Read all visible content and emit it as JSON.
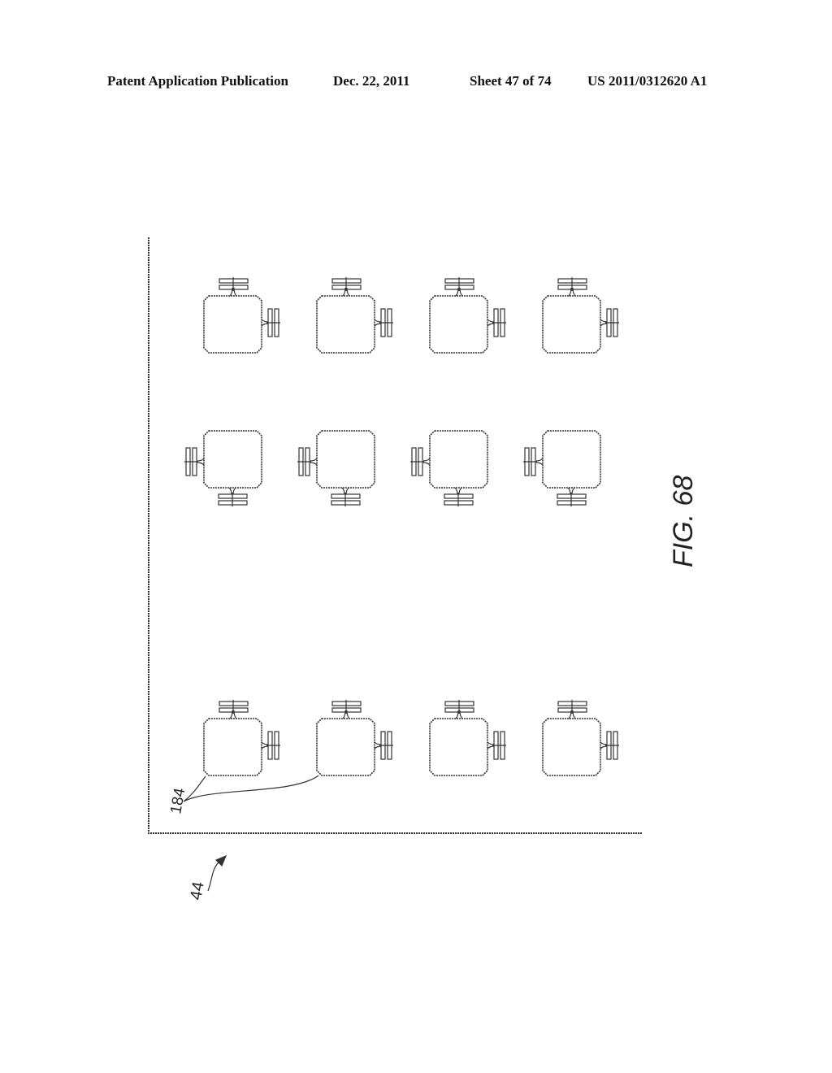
{
  "header": {
    "publication": "Patent Application Publication",
    "date": "Dec. 22, 2011",
    "sheet": "Sheet 47 of 74",
    "number": "US 2011/0312620 A1"
  },
  "figure": {
    "caption": "FIG. 68",
    "substrate_ref": "44",
    "component_ref": "184",
    "rows": [
      {
        "orientation": "top-right",
        "count": 4
      },
      {
        "orientation": "left-bottom",
        "count": 4
      },
      {
        "orientation": "top-right",
        "count": 4
      }
    ],
    "colors": {
      "line": "#333333",
      "background": "#ffffff"
    }
  }
}
